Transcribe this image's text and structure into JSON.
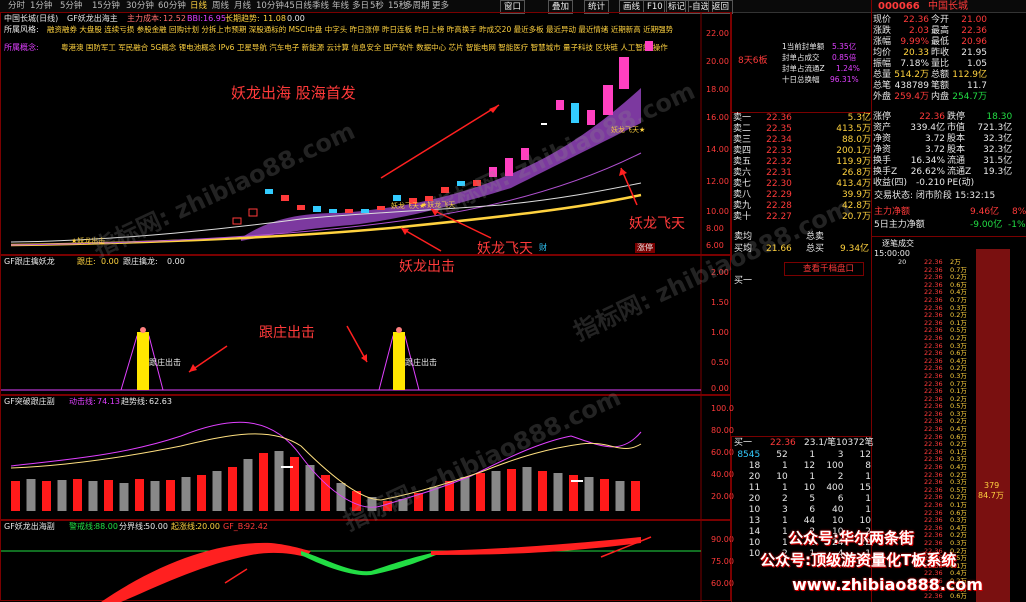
{
  "toolbar": {
    "timeframes": [
      "分时",
      "1分钟",
      "5分钟",
      "15分钟",
      "30分钟",
      "60分钟",
      "日线",
      "周线",
      "月线",
      "10分钟",
      "45日线",
      "季线",
      "年线",
      "多日",
      "5秒",
      "15秒",
      "多周期",
      "更多"
    ],
    "right_buttons": [
      "窗口",
      "叠加",
      "统计",
      "画线",
      "F10",
      "标记",
      "-自选",
      "返回"
    ]
  },
  "main_chart": {
    "title": "中国长城(日线)",
    "indicator_name": "GF妖龙出海主",
    "legend": [
      {
        "label": "主力成本:",
        "value": "12.52",
        "color": "#ff6e6e"
      },
      {
        "label": "BBI:",
        "value": "16.95",
        "color": "#e040ff"
      },
      {
        "label": "长期趋势:",
        "value": "11.08",
        "color": "#ffd23f"
      },
      {
        "label": "0.00",
        "value": "",
        "color": "#e8e8e8"
      }
    ],
    "concept_label_1": "所属风格:",
    "concept_text_1": "融资融券 大盘股 连续亏损 参股金融 回购计划 分拆上市预期 深股通标的 MSCI中盘 中字头 昨日涨停 昨日连板 昨日上榜 昨高换手 昨成交20 最近多板 最近异动 最近情绪 近期新高 近期强势",
    "concept_label_2": "所属概念:",
    "concept_text_2": "粤港澳 国防军工 军民融合 5G概念 锂电池概念 IPv6 卫星导航 汽车电子 新能源 云计算 信息安全 国产软件 数据中心 芯片 智能电网 智能医疗 智慧城市 量子科技 区块链 人工智能 操作",
    "axis_labels": [
      "22.00",
      "20.00",
      "18.00",
      "16.00",
      "14.00",
      "12.00",
      "10.00",
      "8.00",
      "6.00"
    ],
    "annotations": [
      "妖龙出海 股海首发",
      "妖龙出击",
      "妖龙飞天",
      "妖龙飞天"
    ],
    "marks": [
      "★妖龙出击",
      "妖龙飞天★",
      "★妖龙飞天",
      "妖龙飞天★",
      "财",
      "涨停"
    ]
  },
  "panel2": {
    "title": "GF跟庄擒妖龙",
    "legend": [
      {
        "label": "跟庄:",
        "value": "0.00",
        "color": "#ffd23f"
      },
      {
        "label": "跟庄擒龙:",
        "value": "0.00",
        "color": "#e8e8e8"
      }
    ],
    "axis_labels": [
      "2.00",
      "1.50",
      "1.00",
      "0.50",
      "0.00"
    ],
    "annotation": "跟庄出击",
    "bar_label": "跟庄出击"
  },
  "panel3": {
    "title": "GF突破跟庄副",
    "legend": [
      {
        "label": "动击线:",
        "value": "74.13",
        "color": "#e040ff"
      },
      {
        "label": "趋势线:",
        "value": "62.63",
        "color": "#e8e8e8"
      }
    ],
    "axis_labels": [
      "100.0",
      "80.00",
      "60.00",
      "40.00",
      "20.00"
    ]
  },
  "panel4": {
    "title": "GF妖龙出海副",
    "legend": [
      {
        "label": "警戒线:",
        "value": "88.00",
        "color": "#22dd44"
      },
      {
        "label": "分界线:",
        "value": "50.00",
        "color": "#e8e8e8"
      },
      {
        "label": "起涨线:",
        "value": "20.00",
        "color": "#ffd23f"
      },
      {
        "label": "GF_B:",
        "value": "92.42",
        "color": "#ff3a3a"
      }
    ],
    "axis_labels": [
      "90.00",
      "75.00",
      "60.00"
    ]
  },
  "watermarks": [
    "指标网: zhibiao88.com",
    "指标网: zhibiao88.com",
    "指标网: zhibiao888.com",
    "指标网: zhibiao888.com"
  ],
  "seal": {
    "lines": [
      "8天6板"
    ],
    "stats": [
      {
        "label": "1当前封单额",
        "value": "5.35亿"
      },
      {
        "label": "封单占成交",
        "value": "0.85倍"
      },
      {
        "label": "封单占流通Z",
        "value": "1.24%"
      },
      {
        "label": "十日总换幅",
        "value": "96.31%"
      }
    ]
  },
  "stock": {
    "code": "000066",
    "name": "中国长城",
    "info": [
      [
        {
          "k": "现价",
          "v": "22.36",
          "c": "red"
        },
        {
          "k": "今开",
          "v": "21.00",
          "c": "red"
        }
      ],
      [
        {
          "k": "涨跌",
          "v": "2.03",
          "c": "red"
        },
        {
          "k": "最高",
          "v": "22.36",
          "c": "red"
        }
      ],
      [
        {
          "k": "涨幅",
          "v": "9.99%",
          "c": "red"
        },
        {
          "k": "最低",
          "v": "20.96",
          "c": "red"
        }
      ],
      [
        {
          "k": "均价",
          "v": "20.33",
          "c": "yel"
        },
        {
          "k": "昨收",
          "v": "21.95",
          "c": "wht"
        }
      ],
      [
        {
          "k": "振幅",
          "v": "7.18%",
          "c": "wht"
        },
        {
          "k": "量比",
          "v": "1.05",
          "c": "wht"
        }
      ],
      [
        {
          "k": "总量",
          "v": "514.2万",
          "c": "yel"
        },
        {
          "k": "总额",
          "v": "112.9亿",
          "c": "yel"
        }
      ],
      [
        {
          "k": "总笔",
          "v": "438789",
          "c": "wht"
        },
        {
          "k": "笔额",
          "v": "11.7",
          "c": "wht"
        }
      ],
      [
        {
          "k": "外盘",
          "v": "259.4万",
          "c": "red"
        },
        {
          "k": "内盘",
          "v": "254.7万",
          "c": "grn"
        }
      ]
    ],
    "sell": [
      {
        "k": "卖一",
        "p": "22.36",
        "v": "5.3亿"
      },
      {
        "k": "卖二",
        "p": "22.35",
        "v": "413.5万"
      },
      {
        "k": "卖三",
        "p": "22.34",
        "v": "88.0万"
      },
      {
        "k": "卖四",
        "p": "22.33",
        "v": "200.1万"
      },
      {
        "k": "卖五",
        "p": "22.32",
        "v": "119.9万"
      },
      {
        "k": "卖六",
        "p": "22.31",
        "v": "26.8万"
      },
      {
        "k": "卖七",
        "p": "22.30",
        "v": "413.4万"
      },
      {
        "k": "卖八",
        "p": "22.29",
        "v": "39.9万"
      },
      {
        "k": "卖九",
        "p": "22.28",
        "v": "42.8万"
      },
      {
        "k": "卖十",
        "p": "22.27",
        "v": "20.7万"
      }
    ],
    "detail": [
      [
        {
          "k": "涨停",
          "v": "22.36",
          "c": "red"
        },
        {
          "k": "跌停",
          "v": "18.30",
          "c": "grn"
        }
      ],
      [
        {
          "k": "资产",
          "v": "339.4亿",
          "c": "wht"
        },
        {
          "k": "市值",
          "v": "721.3亿",
          "c": "wht"
        }
      ],
      [
        {
          "k": "净资",
          "v": "3.72",
          "c": "wht"
        },
        {
          "k": "股本",
          "v": "32.3亿",
          "c": "wht"
        }
      ],
      [
        {
          "k": "净资",
          "v": "3.72",
          "c": "wht"
        },
        {
          "k": "股本",
          "v": "32.3亿",
          "c": "wht"
        }
      ],
      [
        {
          "k": "换手",
          "v": "16.34%",
          "c": "wht"
        },
        {
          "k": "流通",
          "v": "31.5亿",
          "c": "wht"
        }
      ],
      [
        {
          "k": "换手Z",
          "v": "26.62%",
          "c": "wht"
        },
        {
          "k": "流通Z",
          "v": "19.3亿",
          "c": "wht"
        }
      ],
      [
        {
          "k": "收益(四)",
          "v": "-0.210",
          "c": "wht"
        },
        {
          "k": "PE(动)",
          "v": "",
          "c": "wht"
        }
      ]
    ],
    "trade_status": "交易状态: 闭市阶段 15:32:15",
    "main_net": {
      "label": "主力净额",
      "v": "9.46亿",
      "p": "8%"
    },
    "main_net5": {
      "label": "5日主力净额",
      "v": "-9.00亿",
      "p": "-1%"
    },
    "market": [
      {
        "k": "卖均",
        "v": "",
        "k2": "总卖",
        "": ""
      },
      {
        "k": "买均",
        "v": "21.66",
        "k2": "总买",
        "v2": "9.34亿"
      }
    ],
    "view_link": "查看千档盘口",
    "buy1": "买一",
    "tick_title": "逐笔成交",
    "tick_open": "15:00:00",
    "ticks": [
      {
        "t": "20",
        "p": "22.36",
        "v": "2万"
      },
      {
        "t": "",
        "p": "22.36",
        "v": "0.7万"
      },
      {
        "t": "",
        "p": "22.36",
        "v": "0.2万"
      },
      {
        "t": "",
        "p": "22.36",
        "v": "0.6万"
      },
      {
        "t": "",
        "p": "22.36",
        "v": "0.4万"
      },
      {
        "t": "",
        "p": "22.36",
        "v": "0.7万"
      },
      {
        "t": "",
        "p": "22.36",
        "v": "0.3万"
      },
      {
        "t": "",
        "p": "22.36",
        "v": "0.2万"
      },
      {
        "t": "",
        "p": "22.36",
        "v": "0.1万"
      },
      {
        "t": "",
        "p": "22.36",
        "v": "0.5万"
      },
      {
        "t": "",
        "p": "22.36",
        "v": "0.2万"
      },
      {
        "t": "",
        "p": "22.36",
        "v": "0.3万"
      },
      {
        "t": "",
        "p": "22.36",
        "v": "0.6万"
      },
      {
        "t": "",
        "p": "22.36",
        "v": "0.4万"
      },
      {
        "t": "",
        "p": "22.36",
        "v": "0.2万"
      },
      {
        "t": "",
        "p": "22.36",
        "v": "0.3万"
      },
      {
        "t": "",
        "p": "22.36",
        "v": "0.7万"
      },
      {
        "t": "",
        "p": "22.36",
        "v": "0.1万"
      },
      {
        "t": "",
        "p": "22.36",
        "v": "0.2万"
      },
      {
        "t": "",
        "p": "22.36",
        "v": "0.5万"
      },
      {
        "t": "",
        "p": "22.36",
        "v": "0.3万"
      },
      {
        "t": "",
        "p": "22.36",
        "v": "0.2万"
      },
      {
        "t": "",
        "p": "22.36",
        "v": "0.4万"
      },
      {
        "t": "",
        "p": "22.36",
        "v": "0.6万"
      },
      {
        "t": "",
        "p": "22.36",
        "v": "0.2万"
      },
      {
        "t": "",
        "p": "22.36",
        "v": "0.1万"
      },
      {
        "t": "",
        "p": "22.36",
        "v": "0.3万"
      },
      {
        "t": "",
        "p": "22.36",
        "v": "0.4万"
      },
      {
        "t": "",
        "p": "22.36",
        "v": "0.2万"
      },
      {
        "t": "",
        "p": "22.36",
        "v": "0.3万"
      },
      {
        "t": "",
        "p": "22.36",
        "v": "0.5万"
      },
      {
        "t": "",
        "p": "22.36",
        "v": "0.2万"
      },
      {
        "t": "",
        "p": "22.36",
        "v": "0.1万"
      },
      {
        "t": "",
        "p": "22.36",
        "v": "0.6万"
      },
      {
        "t": "",
        "p": "22.36",
        "v": "0.3万"
      },
      {
        "t": "",
        "p": "22.36",
        "v": "0.4万"
      },
      {
        "t": "",
        "p": "22.36",
        "v": "0.2万"
      },
      {
        "t": "",
        "p": "22.36",
        "v": "0.3万"
      },
      {
        "t": "",
        "p": "22.36",
        "v": "0.2万"
      },
      {
        "t": "",
        "p": "22.36",
        "v": "0.5万"
      },
      {
        "t": "",
        "p": "22.36",
        "v": "0.1万"
      },
      {
        "t": "",
        "p": "22.36",
        "v": "0.4万"
      },
      {
        "t": "",
        "p": "22.36",
        "v": "0.2万"
      },
      {
        "t": "",
        "p": "22.36",
        "v": "0.3万"
      },
      {
        "t": "",
        "p": "22.36",
        "v": "0.6万"
      }
    ],
    "vol_bar": {
      "v": "379",
      "v2": "84.7万"
    },
    "queue_title": "买一",
    "queue_head": {
      "p": "22.36",
      "c": "23.1/笔",
      "n": "10372笔"
    },
    "queue": [
      [
        "8545",
        "52",
        "1",
        "3",
        "12"
      ],
      [
        "18",
        "1",
        "12",
        "100",
        "8"
      ],
      [
        "20",
        "10",
        "1",
        "2",
        "1"
      ],
      [
        "11",
        "1",
        "10",
        "400",
        "15"
      ],
      [
        "20",
        "2",
        "5",
        "6",
        "1"
      ],
      [
        "10",
        "3",
        "6",
        "40",
        "1"
      ],
      [
        "13",
        "1",
        "44",
        "10",
        "10"
      ],
      [
        "14",
        "1",
        "2",
        "10",
        "2"
      ],
      [
        "10",
        "1",
        "1",
        "24",
        "22"
      ],
      [
        "10",
        "2",
        "1",
        "4",
        "1"
      ]
    ]
  },
  "promo": [
    "公众号:华尔两条街",
    "公众号:顶级游资量化T板系统",
    "www.zhibiao888.com"
  ]
}
